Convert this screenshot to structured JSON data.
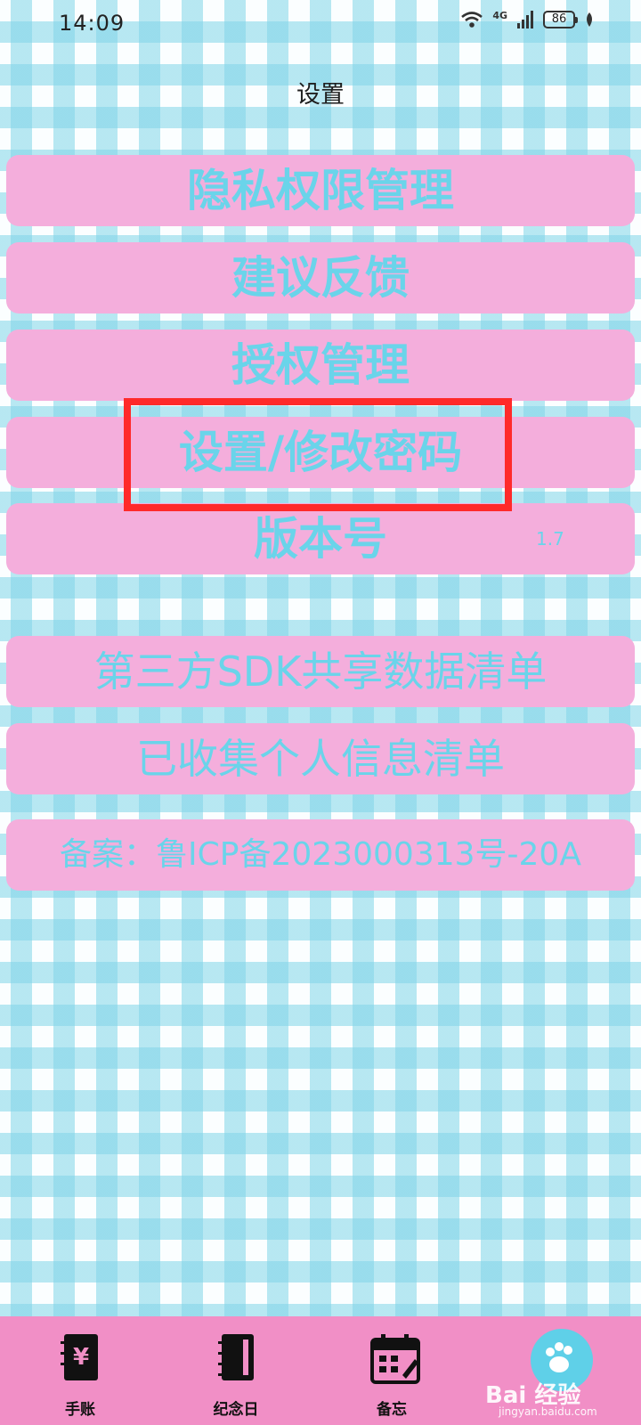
{
  "status_bar": {
    "time": "14:09",
    "network": "4G",
    "battery": "86",
    "icons": [
      "wifi-icon",
      "signal-icon",
      "battery-icon",
      "leaf-icon"
    ]
  },
  "header": {
    "title": "设置"
  },
  "menu": {
    "items": [
      {
        "label": "隐私权限管理"
      },
      {
        "label": "建议反馈"
      },
      {
        "label": "授权管理"
      },
      {
        "label": "设置/修改密码"
      },
      {
        "label": "版本号",
        "value": "1.7"
      },
      {
        "label": "第三方SDK共享数据清单"
      },
      {
        "label": "已收集个人信息清单"
      },
      {
        "label": "备案：鲁ICP备2023000313号-20A"
      }
    ]
  },
  "bottom_nav": {
    "tabs": [
      {
        "label": "手账",
        "icon": "yen-book-icon"
      },
      {
        "label": "纪念日",
        "icon": "notebook-icon"
      },
      {
        "label": "备忘",
        "icon": "calendar-icon"
      },
      {
        "label": "",
        "icon": "paw-icon"
      }
    ]
  },
  "watermark": {
    "text": "Bai 经验",
    "url": "jingyan.baidu.com"
  },
  "colors": {
    "menu_bg": "#f4aedc",
    "menu_text": "#6ad4ea",
    "nav_bg": "#f18fc6",
    "highlight": "#ff2a2a"
  }
}
